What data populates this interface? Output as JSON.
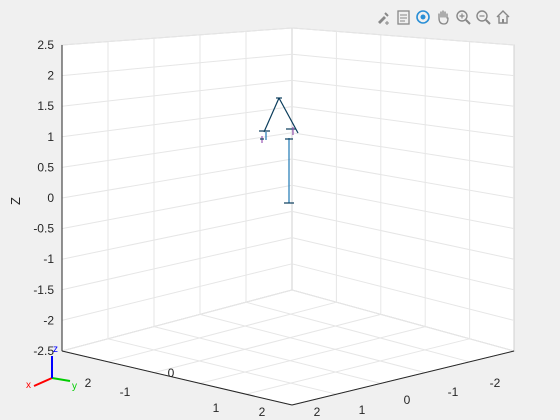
{
  "toolbar": {
    "buttons": [
      {
        "name": "brush-icon"
      },
      {
        "name": "datatips-icon"
      },
      {
        "name": "rotate-3d-icon"
      },
      {
        "name": "pan-hand-icon"
      },
      {
        "name": "zoom-in-icon"
      },
      {
        "name": "zoom-out-icon"
      },
      {
        "name": "home-icon"
      }
    ]
  },
  "axes": {
    "z_label": "Z",
    "z_ticks": [
      "2.5",
      "2",
      "1.5",
      "1",
      "0.5",
      "0",
      "-0.5",
      "-1",
      "-1.5",
      "-2",
      "-2.5"
    ],
    "left_ticks": [
      "2",
      "-1",
      "0",
      "1",
      "2"
    ],
    "right_ticks": [
      "-2",
      "-1",
      "0",
      "1",
      "2"
    ]
  },
  "triad": {
    "x": "x",
    "y": "y",
    "z": "z",
    "x_color": "#ff0000",
    "y_color": "#00cc00",
    "z_color": "#0000ff"
  },
  "colors": {
    "robot": "#1f77b4",
    "robot_dark": "#0b3d5c",
    "grid": "#e6e6e6",
    "box_edge": "#dcdcdc"
  }
}
